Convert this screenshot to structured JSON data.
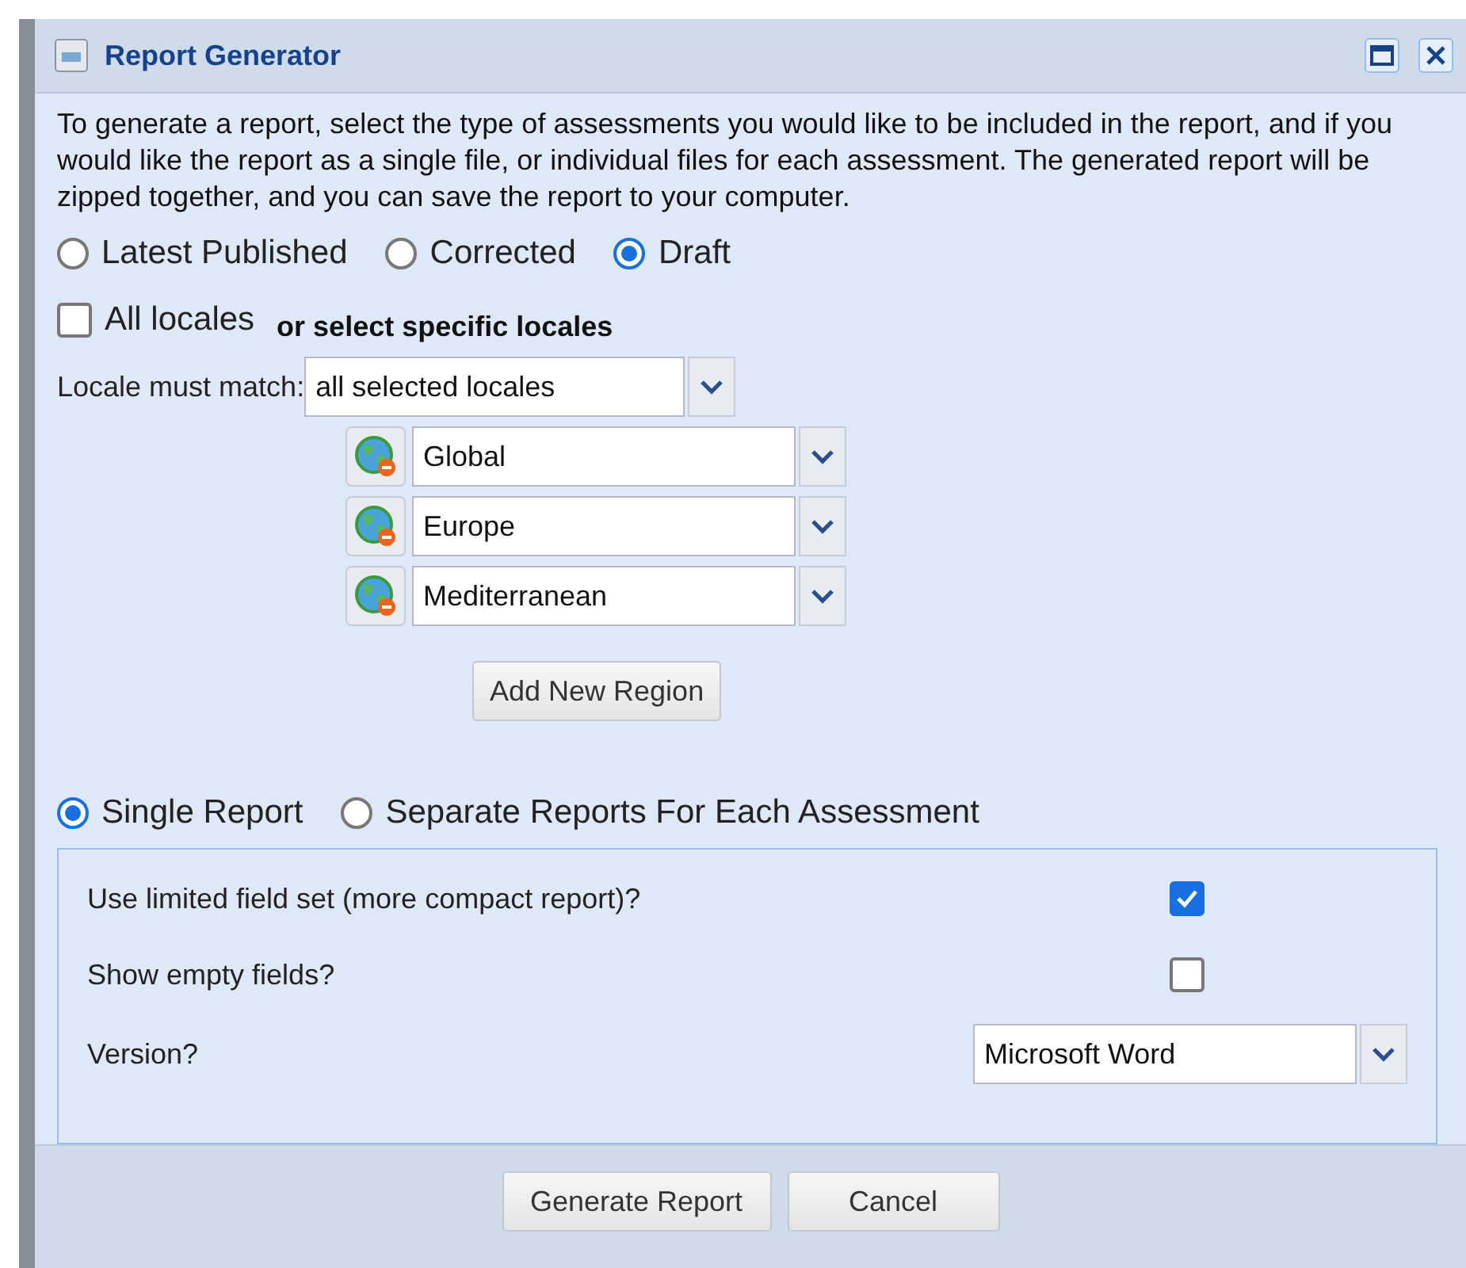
{
  "window": {
    "title": "Report Generator"
  },
  "intro": "To generate a report, select the type of assessments you would like to be included in the report, and if you would like the report as a single file, or individual files for each assessment. The generated report will be zipped together, and you can save the report to your computer.",
  "status_options": [
    {
      "label": "Latest Published",
      "selected": false
    },
    {
      "label": "Corrected",
      "selected": false
    },
    {
      "label": "Draft",
      "selected": true
    }
  ],
  "all_locales": {
    "label": "All locales",
    "checked": false
  },
  "locale_hint": "or select specific locales",
  "locale_match": {
    "label": "Locale must match:",
    "value": "all selected locales"
  },
  "regions": [
    {
      "value": "Global"
    },
    {
      "value": "Europe"
    },
    {
      "value": "Mediterranean"
    }
  ],
  "add_region_button": "Add New Region",
  "report_options": [
    {
      "label": "Single Report",
      "selected": true
    },
    {
      "label": "Separate Reports For Each Assessment",
      "selected": false
    }
  ],
  "settings": [
    {
      "kind": "checkbox",
      "label": "Use limited field set (more compact report)?",
      "checked": true
    },
    {
      "kind": "checkbox",
      "label": "Show empty fields?",
      "checked": false
    },
    {
      "kind": "select",
      "label": "Version?",
      "value": "Microsoft Word"
    }
  ],
  "buttons": [
    "Generate Report",
    "Cancel"
  ]
}
